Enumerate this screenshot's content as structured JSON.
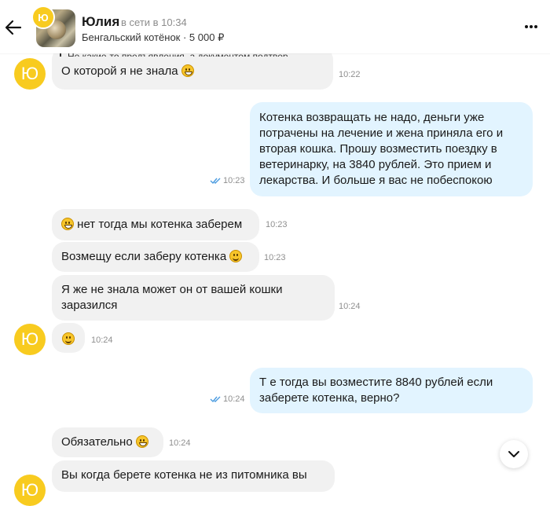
{
  "header": {
    "avatar_letter": "Ю",
    "name": "Юлия",
    "status": "в сети в 10:34",
    "listing": "Бенгальский котёнок · 5 000 ₽"
  },
  "messages": {
    "m1": {
      "reply_preview": "Не какие-то предъявления, а документом подтвер...",
      "text": "О которой я не знала",
      "time": "10:22",
      "avatar": "Ю"
    },
    "m2": {
      "lines": [
        "Котенка возвращать не надо, деньги уже",
        "потрачены на лечение и жена приняла его и",
        "вторая кошка. Прошу возместить поездку в",
        "ветеринарку, на 3840 рублей. Это прием и",
        "лекарства. И больше я вас не побеспокою"
      ],
      "time": "10:23"
    },
    "m3": {
      "text": "нет тогда мы котенка заберем",
      "time": "10:23"
    },
    "m4": {
      "text": "Возмещу если заберу котенка",
      "time": "10:23"
    },
    "m5": {
      "lines": [
        "Я же не знала может он от вашей кошки",
        "заразился"
      ],
      "time": "10:24"
    },
    "m6": {
      "time": "10:24",
      "avatar": "Ю"
    },
    "m7": {
      "lines": [
        "Т е тогда вы возместите 8840 рублей если",
        "заберете котенка, верно?"
      ],
      "time": "10:24"
    },
    "m8": {
      "text": "Обязательно",
      "time": "10:24"
    },
    "m9": {
      "text": "Вы когда берете котенка не из питомника вы",
      "avatar": "Ю"
    }
  },
  "colors": {
    "accent_avatar": "#f8cb1f",
    "outgoing_bubble": "#e2f4ff",
    "incoming_bubble": "#f1f1f1",
    "read_ticks": "#4a9be0"
  }
}
